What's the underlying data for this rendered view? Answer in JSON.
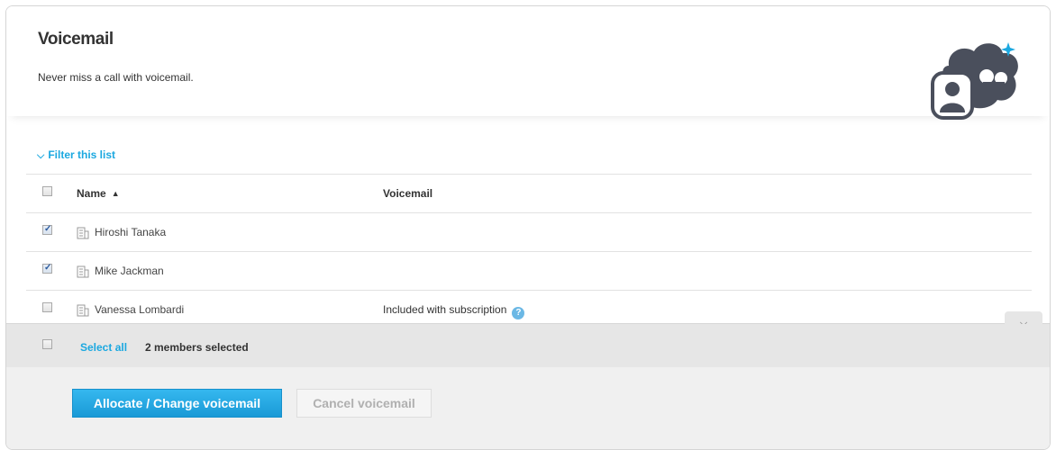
{
  "header": {
    "title": "Voicemail",
    "subtitle": "Never miss a call with voicemail."
  },
  "filter": {
    "label": "Filter this list"
  },
  "table": {
    "columns": {
      "name": "Name",
      "voicemail": "Voicemail"
    },
    "rows": [
      {
        "name": "Hiroshi Tanaka",
        "voicemail": "",
        "checked": true
      },
      {
        "name": "Mike Jackman",
        "voicemail": "",
        "checked": true
      },
      {
        "name": "Vanessa Lombardi",
        "voicemail": "Included with subscription",
        "checked": false
      }
    ]
  },
  "selection": {
    "select_all_label": "Select all",
    "count_label": "2 members selected"
  },
  "actions": {
    "primary_label": "Allocate / Change voicemail",
    "secondary_label": "Cancel voicemail"
  },
  "colors": {
    "accent": "#1ba8e0",
    "illustration": "#4a4f5c",
    "sparkle": "#1ba8e0"
  }
}
